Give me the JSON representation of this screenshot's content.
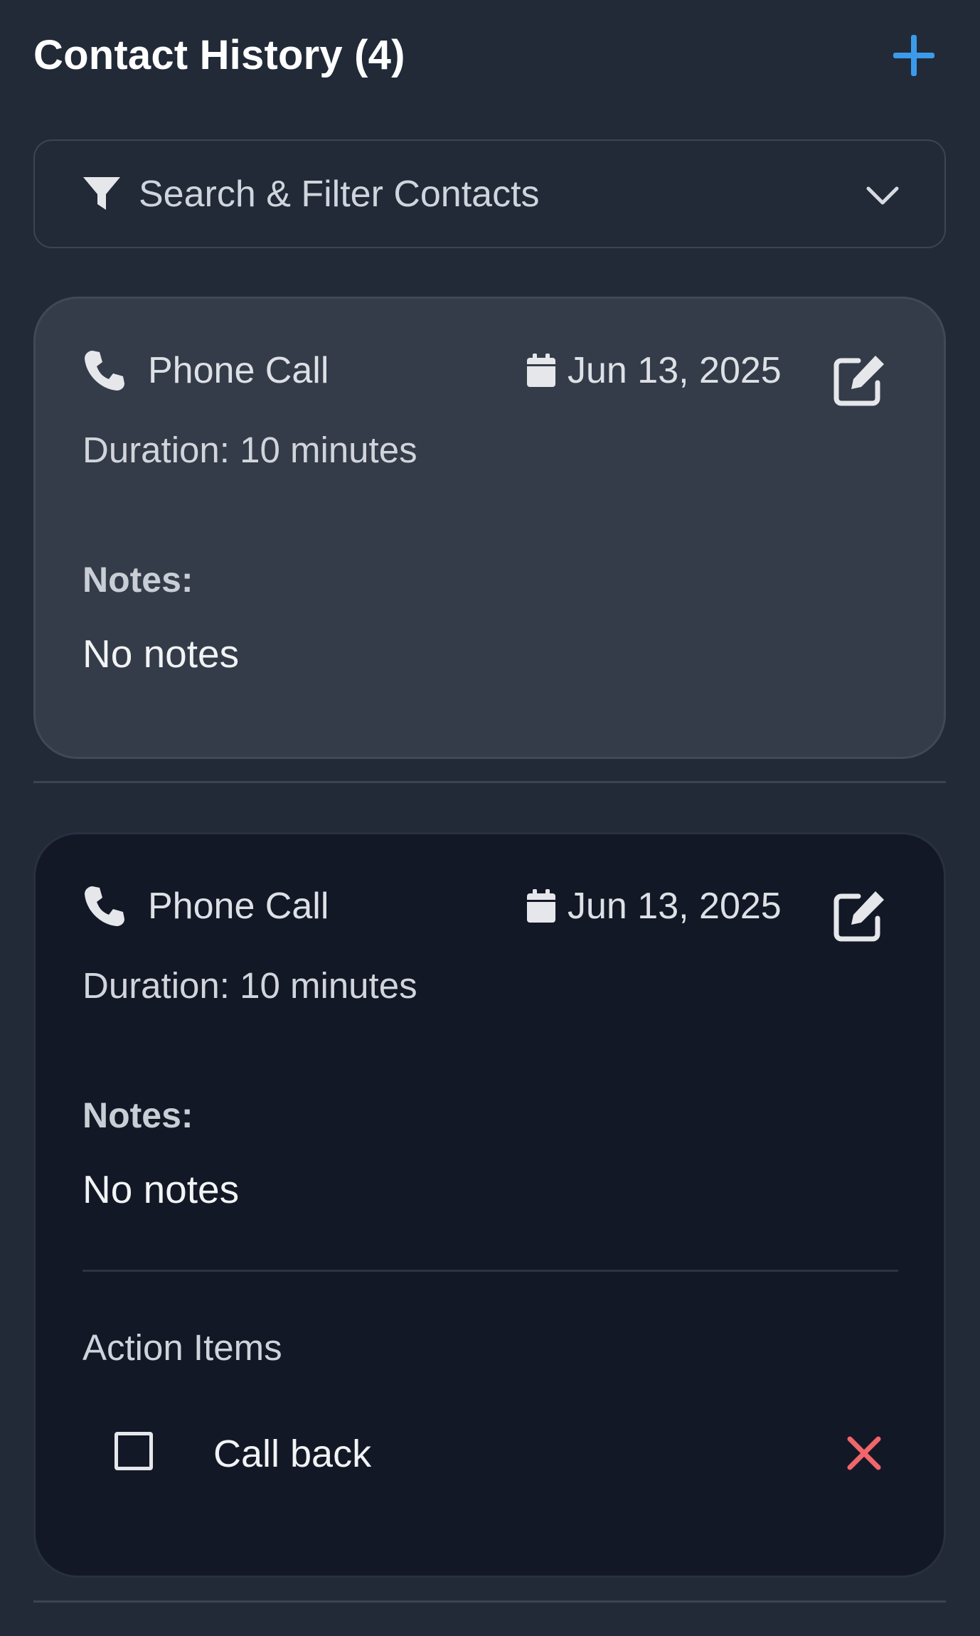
{
  "header": {
    "title": "Contact History (4)",
    "add_icon": "plus-icon",
    "accent": "#3b9bea"
  },
  "filter": {
    "icon": "filter-icon",
    "label": "Search & Filter Contacts",
    "toggle_icon": "chevron-down-icon"
  },
  "contacts": [
    {
      "type": "Phone Call",
      "type_icon": "phone-icon",
      "date_icon": "calendar-icon",
      "date": "Jun 13, 2025",
      "edit_icon": "edit-icon",
      "duration": "Duration: 10 minutes",
      "notes_label": "Notes:",
      "notes": "No notes"
    },
    {
      "type": "Phone Call",
      "type_icon": "phone-icon",
      "date_icon": "calendar-icon",
      "date": "Jun 13, 2025",
      "edit_icon": "edit-icon",
      "duration": "Duration: 10 minutes",
      "notes_label": "Notes:",
      "notes": "No notes",
      "action_items_label": "Action Items",
      "action_items": [
        {
          "text": "Call back",
          "checked": false,
          "remove_icon": "close-icon",
          "remove_color": "#f0666a"
        }
      ]
    }
  ]
}
